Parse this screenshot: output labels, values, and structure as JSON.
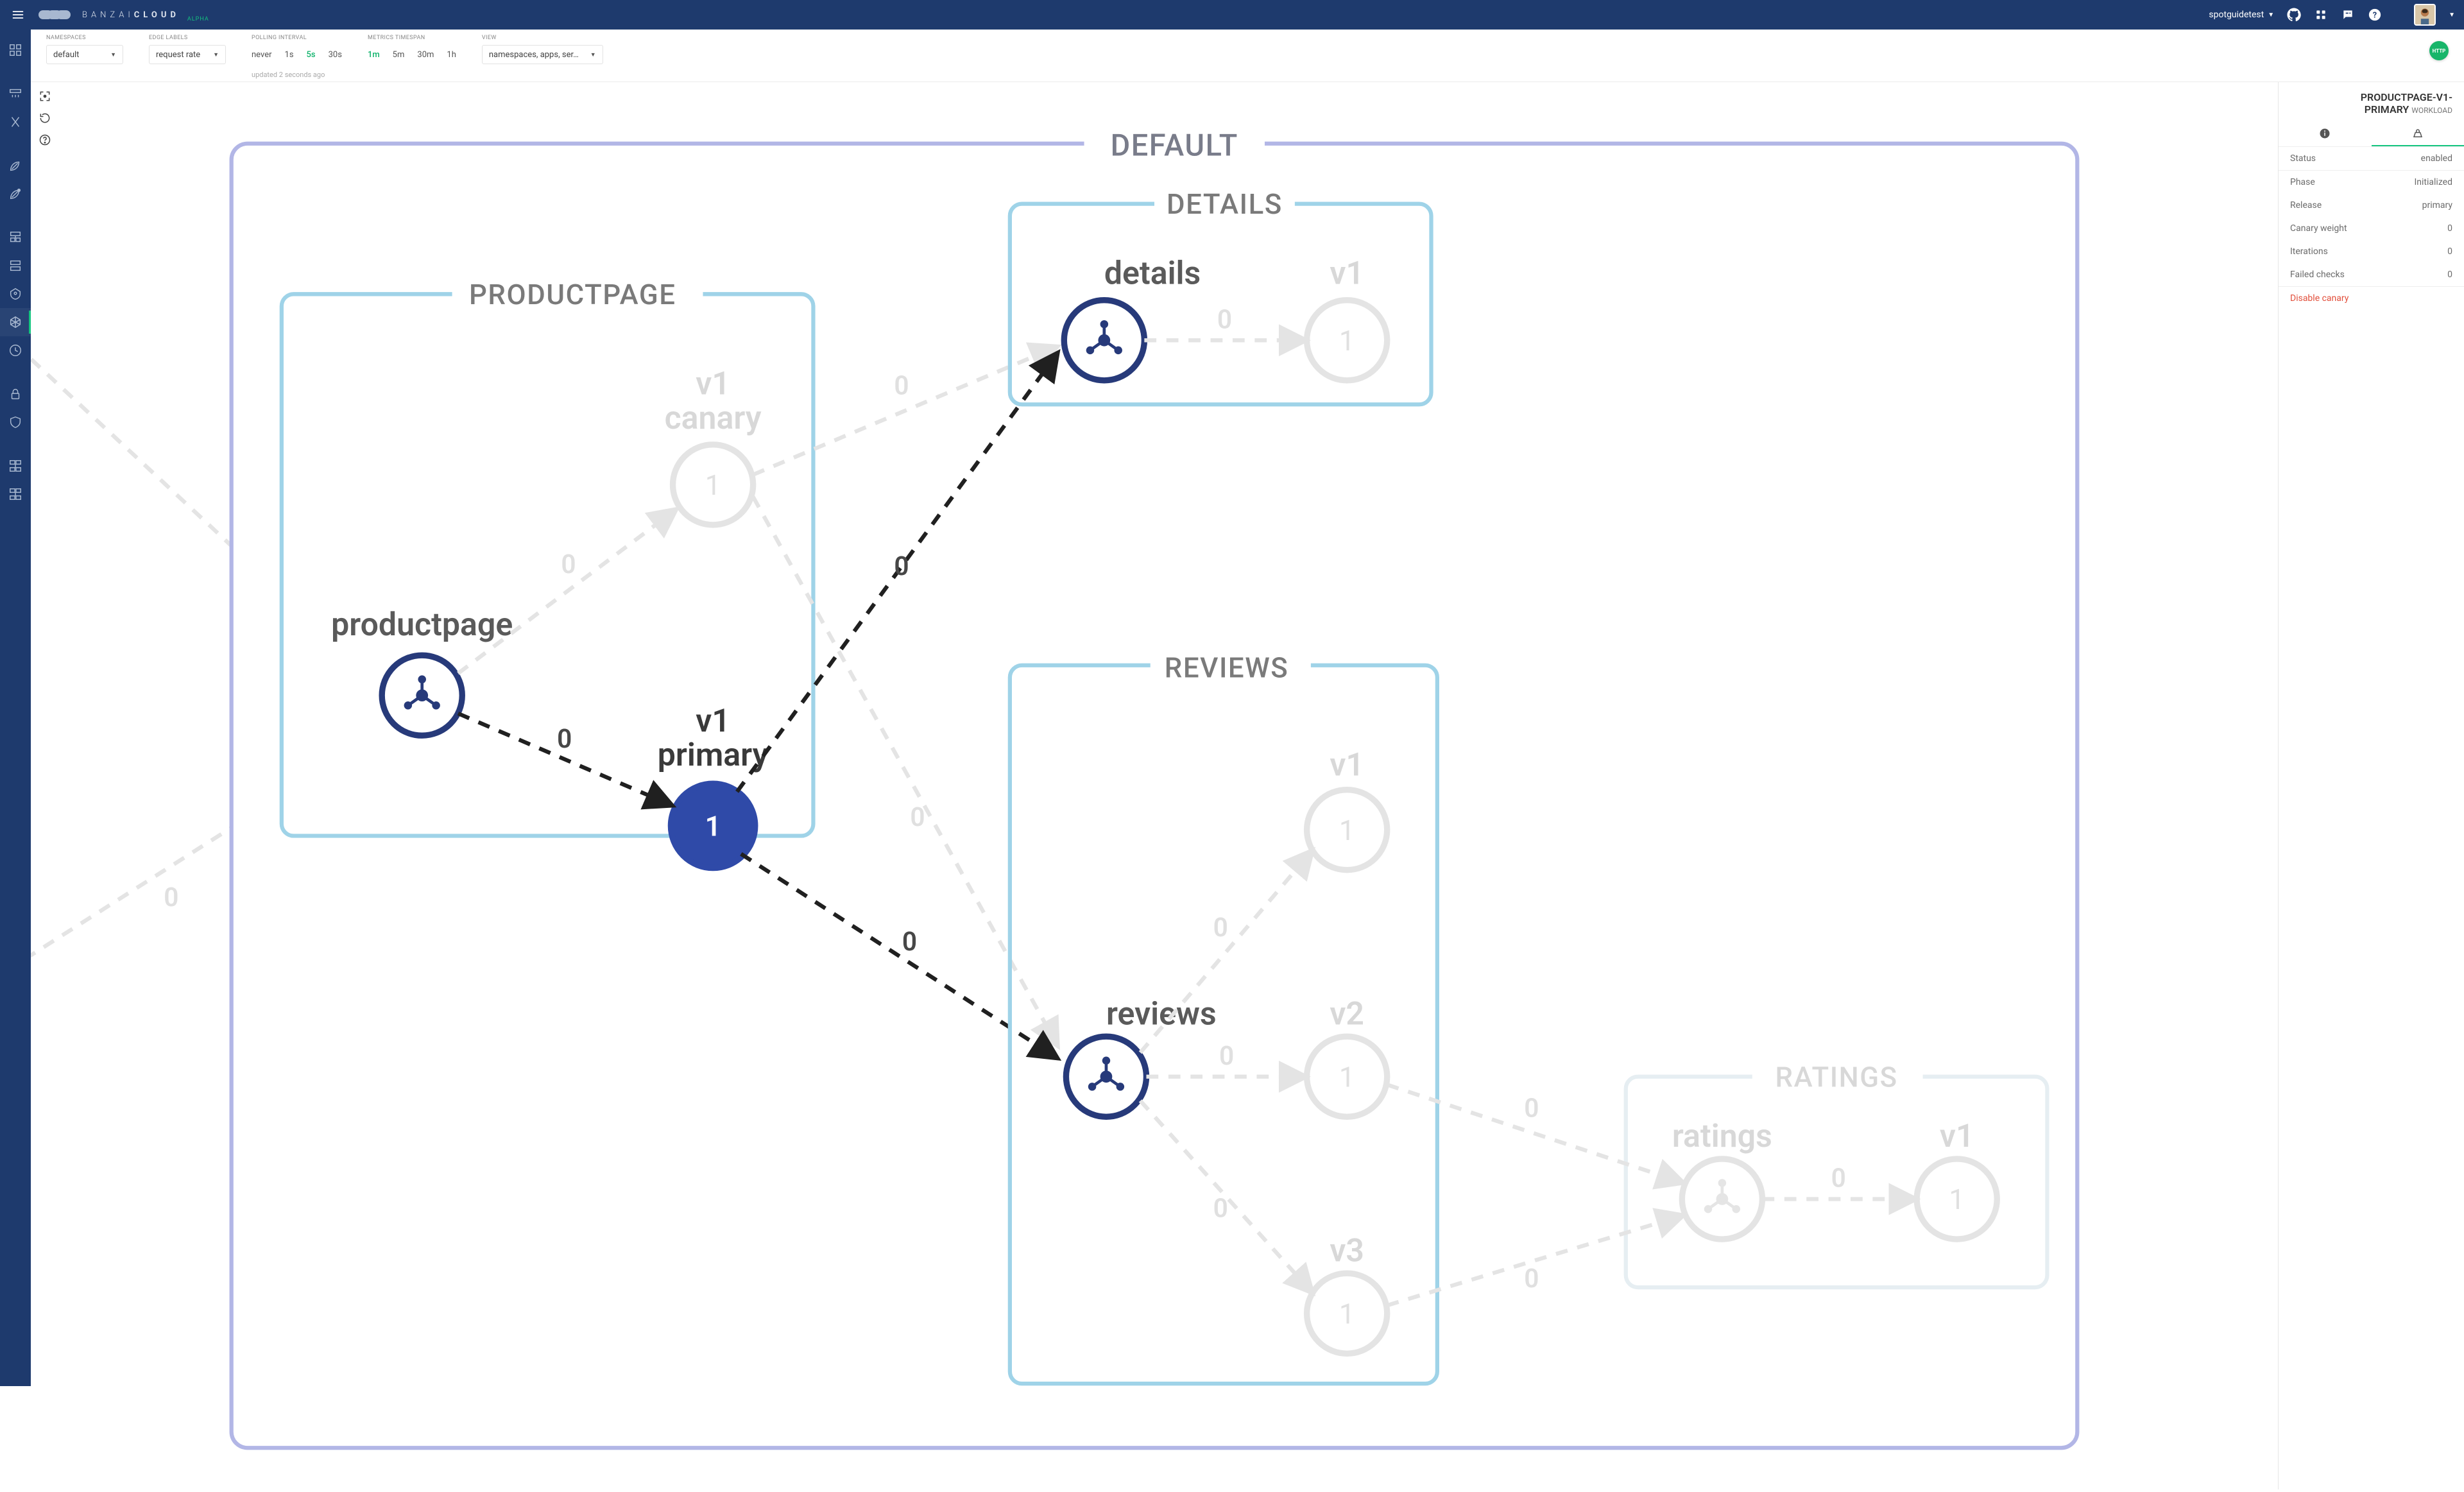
{
  "brand": {
    "part1": "BANZAI",
    "part2": "CLOUD",
    "badge": "ALPHA"
  },
  "org": "spotguidetest",
  "filters": {
    "namespaces": {
      "label": "NAMESPACES",
      "value": "default"
    },
    "edgeLabels": {
      "label": "EDGE LABELS",
      "value": "request rate"
    },
    "polling": {
      "label": "POLLING INTERVAL",
      "options": [
        "never",
        "1s",
        "5s",
        "30s"
      ],
      "selected": "5s"
    },
    "timespan": {
      "label": "METRICS TIMESPAN",
      "options": [
        "1m",
        "5m",
        "30m",
        "1h"
      ],
      "selected": "1m"
    },
    "view": {
      "label": "VIEW",
      "value": "namespaces, apps, ser…"
    },
    "updated": "updated 2 seconds ago"
  },
  "httpBadge": "HTTP",
  "graph": {
    "namespace": "DEFAULT",
    "services": {
      "productpage": {
        "title": "PRODUCTPAGE",
        "label": "productpage",
        "v1canary": {
          "l1": "v1",
          "l2": "canary",
          "num": "1"
        },
        "v1primary": {
          "l1": "v1",
          "l2": "primary",
          "num": "1"
        }
      },
      "details": {
        "title": "DETAILS",
        "label": "details",
        "v1": {
          "l1": "v1",
          "num": "1"
        }
      },
      "reviews": {
        "title": "REVIEWS",
        "label": "reviews",
        "v1": {
          "l1": "v1",
          "num": "1"
        },
        "v2": {
          "l1": "v2",
          "num": "1"
        },
        "v3": {
          "l1": "v3",
          "num": "1"
        }
      },
      "ratings": {
        "title": "RATINGS",
        "label": "ratings",
        "v1": {
          "l1": "v1",
          "num": "1"
        }
      }
    },
    "edgeVal": "0"
  },
  "sidepanel": {
    "title": "PRODUCTPAGE-V1-PRIMARY",
    "subtitle": "WORKLOAD",
    "status": {
      "k": "Status",
      "v": "enabled"
    },
    "rows": [
      {
        "k": "Phase",
        "v": "Initialized"
      },
      {
        "k": "Release",
        "v": "primary"
      },
      {
        "k": "Canary weight",
        "v": "0"
      },
      {
        "k": "Iterations",
        "v": "0"
      },
      {
        "k": "Failed checks",
        "v": "0"
      }
    ],
    "action": "Disable canary"
  }
}
